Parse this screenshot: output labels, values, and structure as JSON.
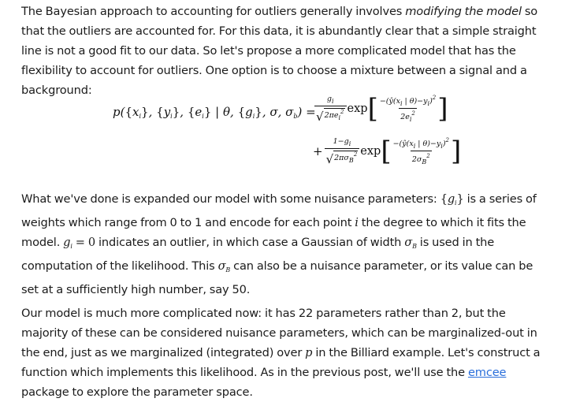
{
  "para1": {
    "before": "The Bayesian approach to accounting for outliers generally involves ",
    "emph": "modifying the model",
    "after": " so that the outliers are accounted for. For this data, it is abundantly clear that a simple straight line is not a good fit to our data. So let's propose a more complicated model that has the flexibility to account for outliers. One option is to choose a mixture between a signal and a background:"
  },
  "equation": {
    "lhs": "p({xᵢ}, {yᵢ}, {eᵢ} | θ, {gᵢ}, σ, σ_b) =",
    "term1": {
      "numerator": "gᵢ",
      "denominator": "√(2πeᵢ²)",
      "exp": "exp",
      "exp_numerator": "−(ŷ(xᵢ | θ)−yᵢ)²",
      "exp_denominator": "2eᵢ²"
    },
    "term2": {
      "prefix": "+",
      "numerator": "1−gᵢ",
      "denominator": "√(2πσ_B²)",
      "exp": "exp",
      "exp_numerator": "−(ŷ(xᵢ | θ)−yᵢ)²",
      "exp_denominator": "2σ_B²"
    }
  },
  "para2": {
    "t1": "What we've done is expanded our model with some nuisance parameters: ",
    "m1": "{gᵢ}",
    "t2": " is a series of weights which range from 0 to 1 and encode for each point ",
    "m2": "i",
    "t3": " the degree to which it fits the model. ",
    "m3": "gᵢ = 0",
    "t4": " indicates an outlier, in which case a Gaussian of width ",
    "m4": "σ_B",
    "t5": " is used in the computation of the likelihood. This ",
    "m5": "σ_B",
    "t6": " can also be a nuisance parameter, or its value can be set at a sufficiently high number, say 50."
  },
  "para3": {
    "t1": "Our model is much more complicated now: it has 22 parameters rather than 2, but the majority of these can be considered nuisance parameters, which can be marginalized-out in the end, just as we marginalized (integrated) over ",
    "m1": "p",
    "t2": " in the Billiard example. Let's construct a function which implements this likelihood. As in the previous post, we'll use the ",
    "link": "emcee",
    "t3": " package to explore the parameter space."
  },
  "colors": {
    "text": "#1b1b1b",
    "link": "#2a6fdb",
    "background": "#ffffff"
  }
}
